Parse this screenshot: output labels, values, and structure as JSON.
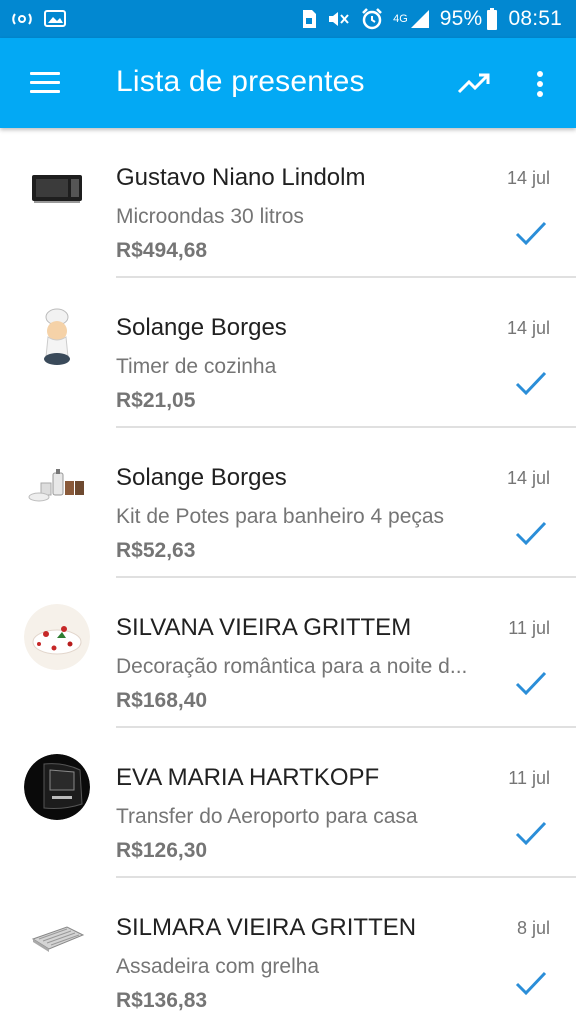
{
  "status_bar": {
    "battery": "95%",
    "time": "08:51",
    "network": "4G",
    "icons_left": [
      "tap-and-pay-icon",
      "photo-icon"
    ],
    "icons_right": [
      "sim-icon",
      "mute-icon",
      "alarm-icon",
      "signal-icon",
      "battery-icon"
    ]
  },
  "app_bar": {
    "title": "Lista de presentes",
    "color": "#03a9f4",
    "icons": [
      "menu-icon",
      "trending-up-icon",
      "more-vert-icon"
    ]
  },
  "check_color": "#2b8ed8",
  "items": [
    {
      "name": "Gustavo Niano Lindolm",
      "description": "Microondas 30 litros",
      "price": "R$494,68",
      "date": "14 jul",
      "image": "microwave",
      "status": "checked"
    },
    {
      "name": "Solange Borges",
      "description": "Timer de cozinha",
      "price": "R$21,05",
      "date": "14 jul",
      "image": "chef-timer",
      "status": "checked"
    },
    {
      "name": "Solange Borges",
      "description": "Kit de Potes para banheiro 4 peças",
      "price": "R$52,63",
      "date": "14 jul",
      "image": "bathroom-kit",
      "status": "checked"
    },
    {
      "name": "SILVANA VIEIRA GRITTEM",
      "description": "Decoração romântica para a noite d...",
      "price": "R$168,40",
      "date": "11 jul",
      "image": "romantic-decoration",
      "status": "checked"
    },
    {
      "name": "EVA MARIA HARTKOPF",
      "description": "Transfer do Aeroporto para casa",
      "price": "R$126,30",
      "date": "11 jul",
      "image": "car",
      "status": "checked"
    },
    {
      "name": "SILMARA VIEIRA GRITTEN",
      "description": "Assadeira com grelha",
      "price": "R$136,83",
      "date": "8 jul",
      "image": "baking-tray",
      "status": "checked"
    }
  ]
}
